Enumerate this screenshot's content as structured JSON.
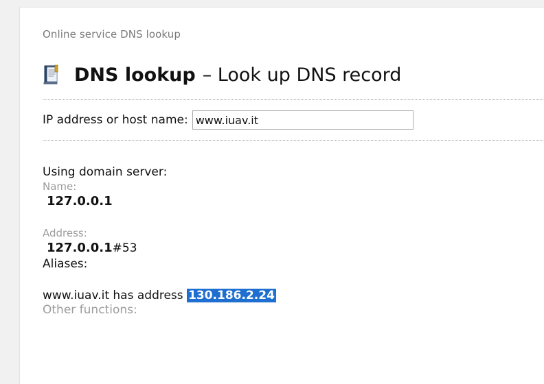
{
  "page": {
    "breadcrumb": "Online service DNS lookup",
    "title_bold": "DNS lookup",
    "title_rest": "– Look up DNS record",
    "title_icon": "book-icon"
  },
  "form": {
    "label": "IP address or host name:",
    "value": "www.iuav.it"
  },
  "result": {
    "using_server": "Using domain server:",
    "name_label": "Name:",
    "name_value": "127.0.0.1",
    "address_label": "Address:",
    "address_value": "127.0.0.1",
    "address_port": "#53",
    "aliases_label": "Aliases:",
    "answer_prefix": "www.iuav.it has address",
    "answer_ip": "130.186.2.24",
    "other_functions": "Other functions:"
  },
  "colors": {
    "highlight": "#1e6fd0",
    "muted_text": "#9c9c9c"
  }
}
